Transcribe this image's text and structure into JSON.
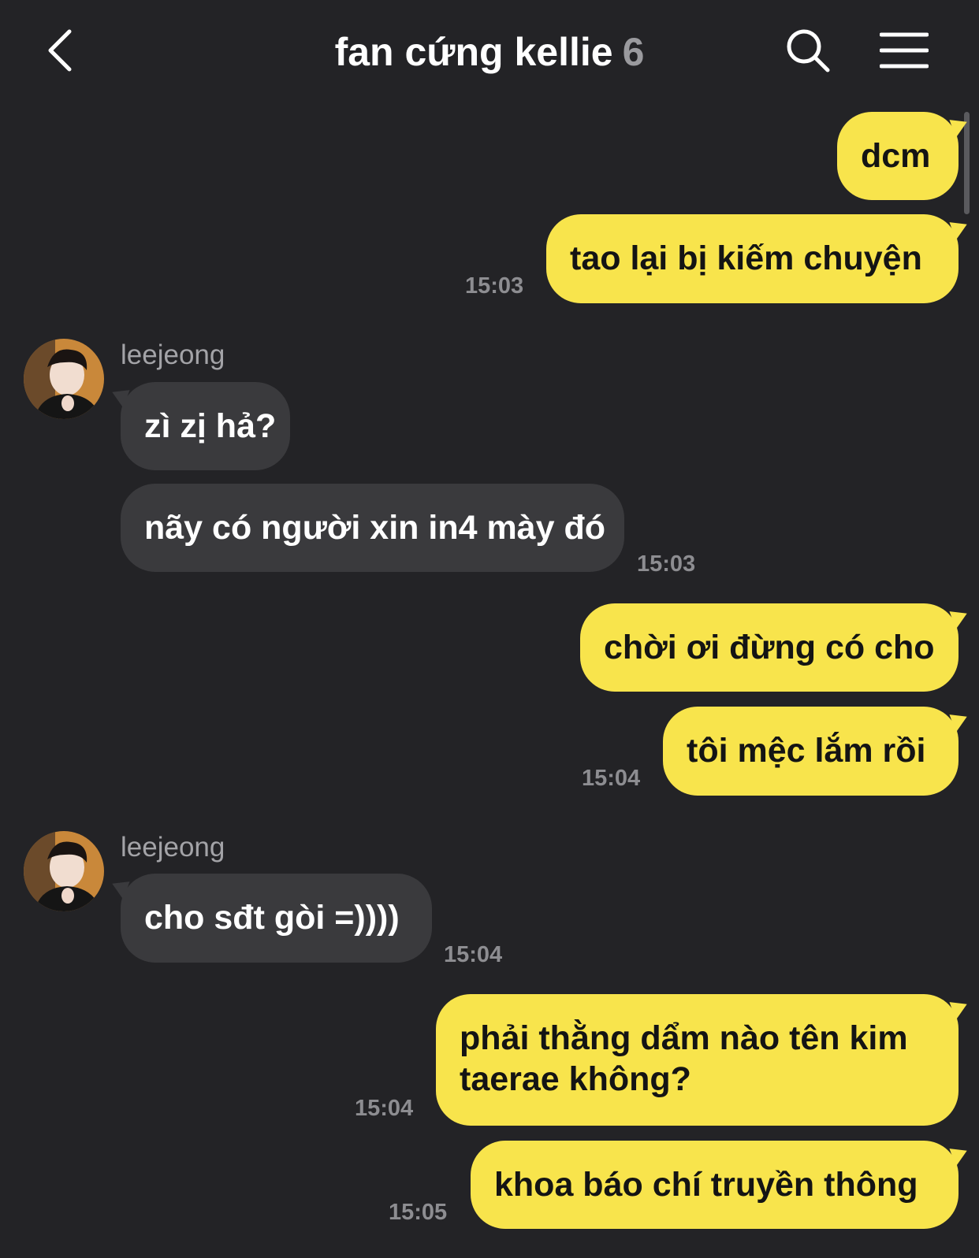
{
  "header": {
    "back_icon": "chevron-left-icon",
    "title": "fan cứng kellie",
    "member_count": "6",
    "search_icon": "search-icon",
    "menu_icon": "hamburger-menu-icon"
  },
  "colors": {
    "background": "#232326",
    "my_bubble": "#f8e44c",
    "their_bubble": "#3a3a3d",
    "timestamp": "#8d8d91"
  },
  "messages": [
    {
      "from": "me",
      "text": "dcm"
    },
    {
      "from": "me",
      "text": "tao lại bị kiếm chuyện",
      "time": "15:03"
    },
    {
      "from": "leejeong",
      "sender": "leejeong",
      "text": "zì zị hả?"
    },
    {
      "from": "leejeong",
      "text": "nãy có người xin in4 mày đó",
      "time": "15:03"
    },
    {
      "from": "me",
      "text": "chời ơi đừng có cho"
    },
    {
      "from": "me",
      "text": "tôi mệc lắm rồi",
      "time": "15:04"
    },
    {
      "from": "leejeong",
      "sender": "leejeong",
      "text": "cho sđt gòi =))))",
      "time": "15:04"
    },
    {
      "from": "me",
      "line1": "phải thằng dẩm nào tên kim",
      "line2": "taerae không?",
      "time": "15:04"
    },
    {
      "from": "me",
      "text": "khoa báo chí truyền thông",
      "time": "15:05"
    }
  ]
}
